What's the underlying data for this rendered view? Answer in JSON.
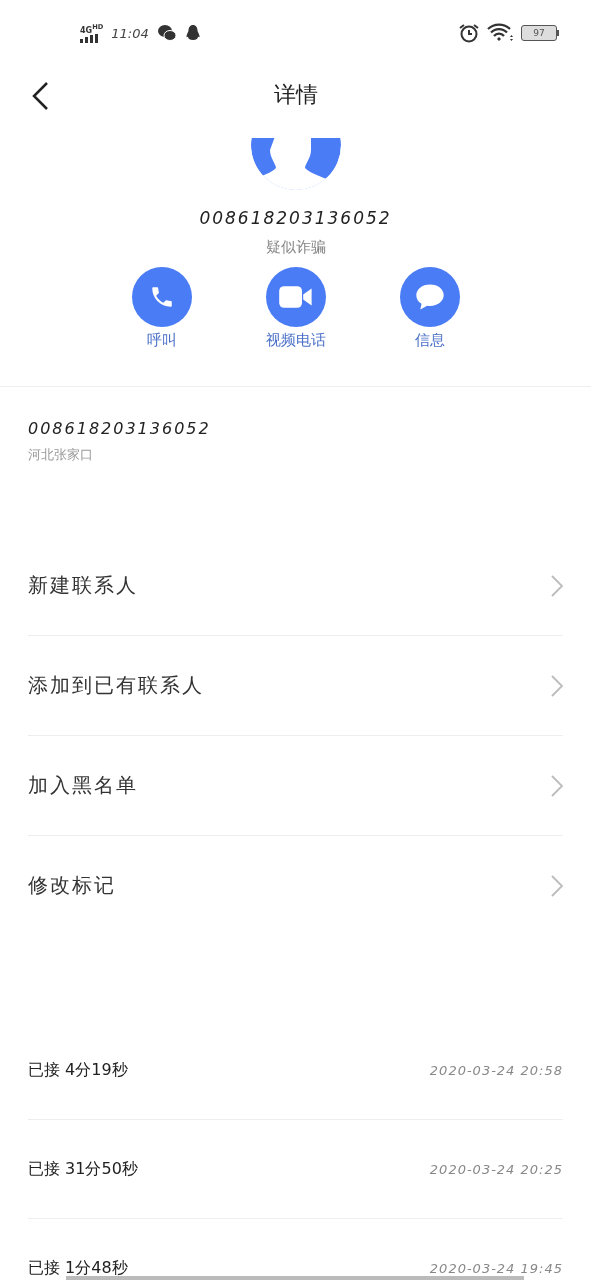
{
  "status_bar": {
    "network": "4G",
    "network_badge": "HD",
    "time": "11:04",
    "battery": "97"
  },
  "header": {
    "title": "详情"
  },
  "contact": {
    "number": "008618203136052",
    "tag": "疑似诈骗"
  },
  "actions": [
    {
      "kind": "call",
      "label": "呼叫"
    },
    {
      "kind": "video",
      "label": "视频电话"
    },
    {
      "kind": "message",
      "label": "信息"
    }
  ],
  "number_info": {
    "number": "008618203136052",
    "location": "河北张家口"
  },
  "menu": [
    "新建联系人",
    "添加到已有联系人",
    "加入黑名单",
    "修改标记"
  ],
  "call_log": [
    {
      "status": "已接",
      "duration": "4分19秒",
      "time": "2020-03-24 20:58"
    },
    {
      "status": "已接",
      "duration": "31分50秒",
      "time": "2020-03-24 20:25"
    },
    {
      "status": "已接",
      "duration": "1分48秒",
      "time": "2020-03-24 19:45"
    }
  ]
}
